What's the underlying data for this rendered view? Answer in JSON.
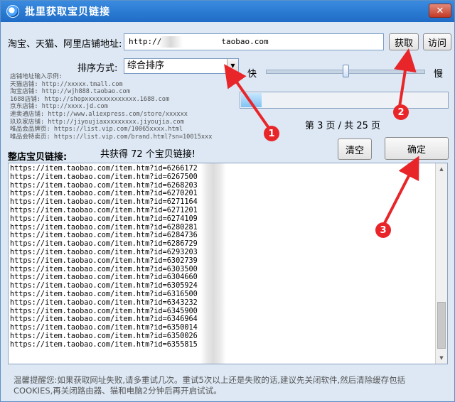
{
  "window": {
    "title": "批里获取宝贝链接",
    "close_label": "✕"
  },
  "shop": {
    "label": "淘宝、天猫、阿里店铺地址:",
    "url_prefix": "http://",
    "url_suffix": "taobao.com",
    "fetch_label": "获取",
    "visit_label": "访问"
  },
  "sort": {
    "label": "排序方式:",
    "selected": "综合排序"
  },
  "speed": {
    "fast_label": "快",
    "slow_label": "慢",
    "level": 0.5
  },
  "examples": [
    "店铺地址输入示例:",
    "天猫店铺: http://xxxxx.tmall.com",
    "淘宝店铺: http://wjh888.taobao.com",
    "1688店铺: http://shopxxxxxxxxxxxxxx.1688.com",
    "京东店铺: http://xxxx.jd.com",
    "速卖通店铺: http://www.aliexpress.com/store/xxxxxx",
    "玖玖家店铺: http://jiyoujiaxxxxxxxxx.jiyoujia.com",
    "唯品会品牌页: https://list.vip.com/10065xxxx.html",
    "唯品会特卖页: https://list.vip.com/brand.html?sn=10015xxx"
  ],
  "progress": {
    "fraction": 0.1
  },
  "paging": {
    "text": "第 3 页 / 共 25 页"
  },
  "links_section": {
    "label": "整店宝贝链接:",
    "count_text": "共获得 72 个宝贝链接!",
    "clear_label": "清空",
    "confirm_label": "确定",
    "items": [
      "https://item.taobao.com/item.htm?id=6266172",
      "https://item.taobao.com/item.htm?id=6267500",
      "https://item.taobao.com/item.htm?id=6268203",
      "https://item.taobao.com/item.htm?id=6270201",
      "https://item.taobao.com/item.htm?id=6271164",
      "https://item.taobao.com/item.htm?id=6271201",
      "https://item.taobao.com/item.htm?id=6274109",
      "https://item.taobao.com/item.htm?id=6280281",
      "https://item.taobao.com/item.htm?id=6284736",
      "https://item.taobao.com/item.htm?id=6286729",
      "https://item.taobao.com/item.htm?id=6293203",
      "https://item.taobao.com/item.htm?id=6302739",
      "https://item.taobao.com/item.htm?id=6303500",
      "https://item.taobao.com/item.htm?id=6304660",
      "https://item.taobao.com/item.htm?id=6305924",
      "https://item.taobao.com/item.htm?id=6316500",
      "https://item.taobao.com/item.htm?id=6343232",
      "https://item.taobao.com/item.htm?id=6345900",
      "https://item.taobao.com/item.htm?id=6346964",
      "https://item.taobao.com/item.htm?id=6350014",
      "https://item.taobao.com/item.htm?id=6350026",
      "https://item.taobao.com/item.htm?id=6355815"
    ]
  },
  "footer": {
    "tip": "温馨提醒您:如果获取网址失败,请多重试几次。重试5次以上还是失败的话,建议先关闭软件,然后清除缓存包括COOKIES,再关闭路由器、猫和电脑2分钟后再开启试试。"
  },
  "annotations": {
    "badge1": "1",
    "badge2": "2",
    "badge3": "3",
    "color": "#e8262a"
  },
  "colors": {
    "titlebar": "#2b7bd6",
    "window_bg": "#dde8f4"
  }
}
